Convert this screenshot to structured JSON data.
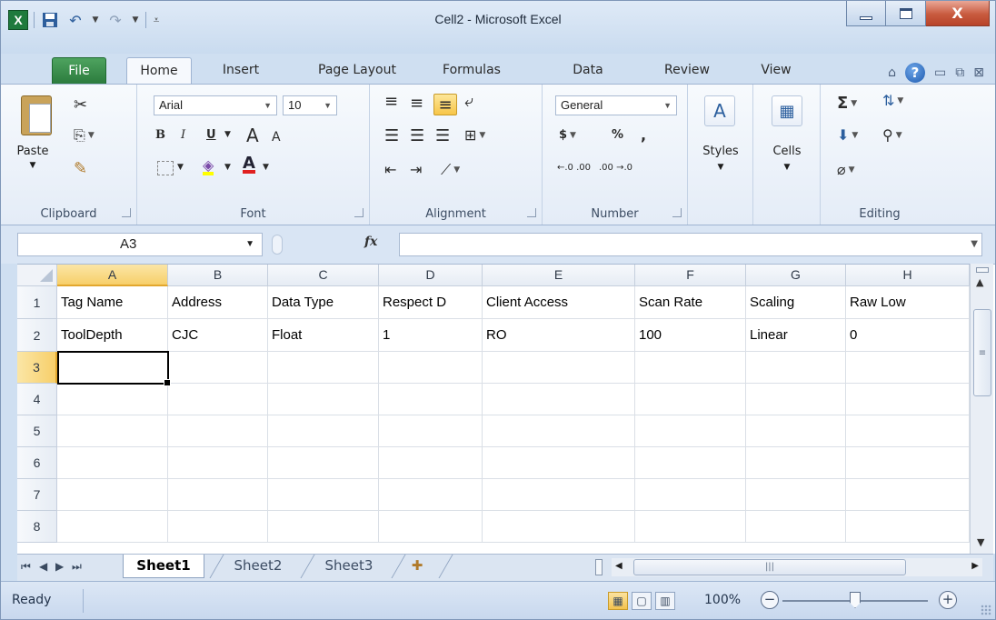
{
  "window": {
    "title": "Cell2 - Microsoft Excel",
    "close_glyph": "X"
  },
  "ribbon_tabs": [
    "File",
    "Home",
    "Insert",
    "Page Layout",
    "Formulas",
    "Data",
    "Review",
    "View"
  ],
  "active_tab": "Home",
  "ribbon": {
    "clipboard": {
      "label": "Clipboard",
      "paste": "Paste"
    },
    "font": {
      "label": "Font",
      "name": "Arial",
      "size": "10",
      "bold": "B",
      "italic": "I",
      "underline": "U",
      "grow": "A",
      "shrink": "A",
      "fill_glyph": "◈",
      "color_glyph": "A"
    },
    "alignment": {
      "label": "Alignment"
    },
    "number": {
      "label": "Number",
      "format": "General",
      "currency": "$",
      "percent": "%",
      "comma": ",",
      "inc_dec": "←.0 .00",
      "dec_dec": ".00 →.0"
    },
    "styles": {
      "label": "Styles"
    },
    "cells": {
      "label": "Cells"
    },
    "editing": {
      "label": "Editing",
      "sum": "Σ"
    }
  },
  "formula_bar": {
    "name_box": "A3",
    "fx": "fx",
    "value": ""
  },
  "grid": {
    "columns": [
      "A",
      "B",
      "C",
      "D",
      "E",
      "F",
      "G",
      "H"
    ],
    "selected_column": "A",
    "rows": [
      "1",
      "2",
      "3",
      "4",
      "5",
      "6",
      "7",
      "8"
    ],
    "selected_row": "3",
    "active_cell": "A3",
    "cells": [
      [
        "Tag Name",
        "Address",
        "Data Type",
        "Respect D",
        "Client Access",
        "Scan Rate",
        "Scaling",
        "Raw Low"
      ],
      [
        "ToolDepth",
        "CJC",
        "Float",
        "1",
        "RO",
        "100",
        "Linear",
        "0"
      ],
      [
        "",
        "",
        "",
        "",
        "",
        "",
        "",
        ""
      ],
      [
        "",
        "",
        "",
        "",
        "",
        "",
        "",
        ""
      ],
      [
        "",
        "",
        "",
        "",
        "",
        "",
        "",
        ""
      ],
      [
        "",
        "",
        "",
        "",
        "",
        "",
        "",
        ""
      ],
      [
        "",
        "",
        "",
        "",
        "",
        "",
        "",
        ""
      ],
      [
        "",
        "",
        "",
        "",
        "",
        "",
        "",
        ""
      ]
    ]
  },
  "sheet_tabs": [
    "Sheet1",
    "Sheet2",
    "Sheet3"
  ],
  "active_sheet": "Sheet1",
  "status": {
    "ready": "Ready",
    "zoom": "100%",
    "zoom_out": "−",
    "zoom_in": "+"
  },
  "icons": {
    "qat": [
      "excel-logo-icon",
      "save-icon",
      "undo-icon",
      "redo-icon",
      "customize-qat-icon"
    ],
    "nav": [
      "first-sheet-icon",
      "prev-sheet-icon",
      "next-sheet-icon",
      "last-sheet-icon",
      "insert-sheet-icon"
    ]
  }
}
